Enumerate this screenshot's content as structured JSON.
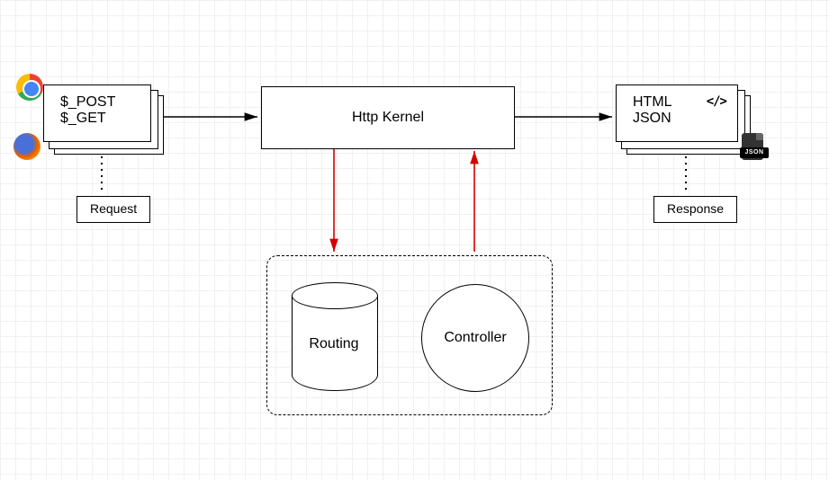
{
  "request_stack": {
    "line1": "$_POST",
    "line2": "$_GET"
  },
  "kernel_label": "Http Kernel",
  "response_stack": {
    "line1": "HTML",
    "line2": "JSON",
    "code_icon": "</>"
  },
  "request_label": "Request",
  "response_label": "Response",
  "routing_label": "Routing",
  "controller_label": "Controller",
  "json_badge_text": "JSON"
}
